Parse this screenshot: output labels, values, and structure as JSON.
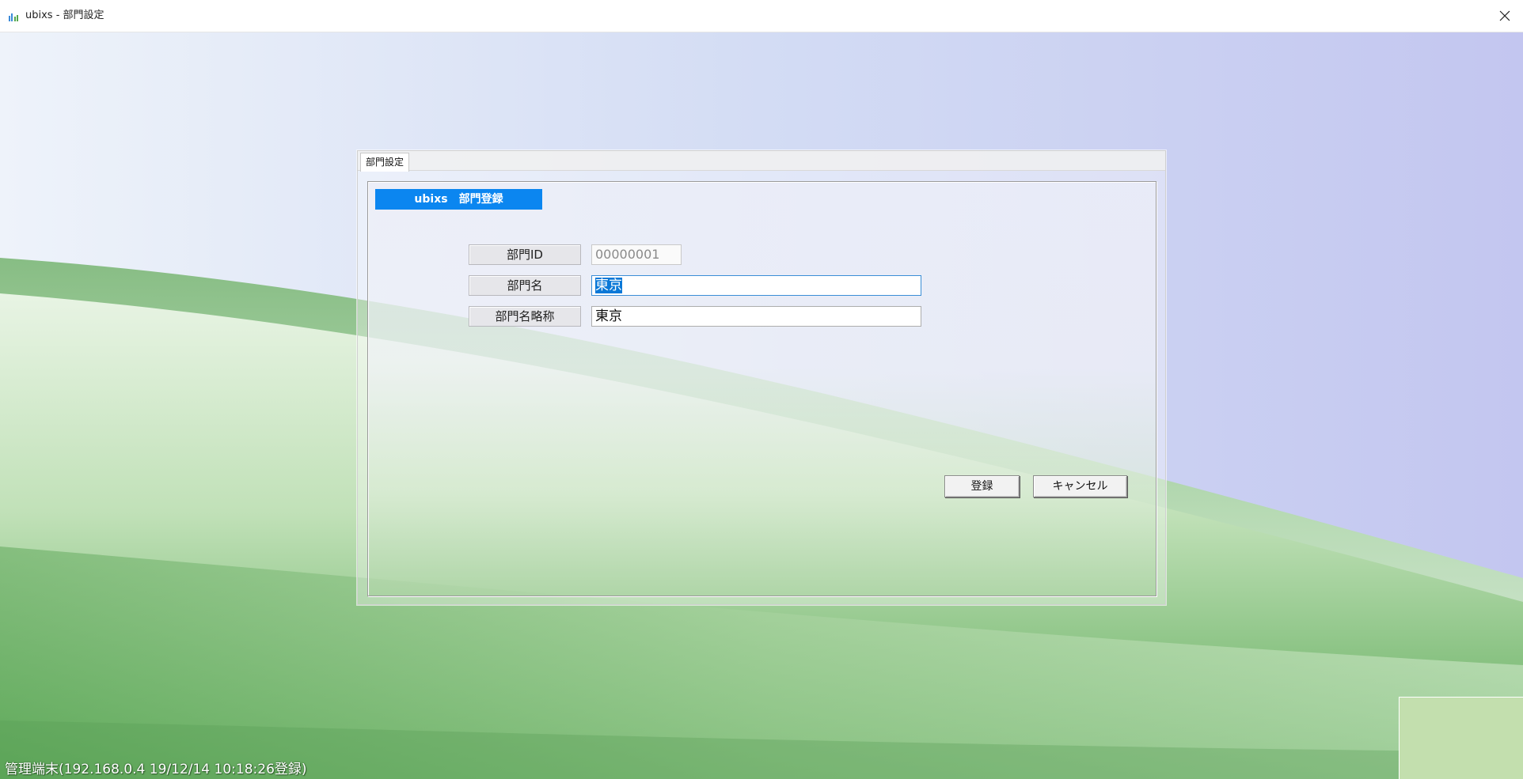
{
  "window": {
    "title": "ubixs - 部門設定"
  },
  "dialog": {
    "tab_label": "部門設定",
    "header": "ubixs　部門登録",
    "fields": [
      {
        "label": "部門ID",
        "value": "00000001",
        "disabled": true
      },
      {
        "label": "部門名",
        "value": "東京",
        "selected": true
      },
      {
        "label": "部門名略称",
        "value": "東京"
      }
    ],
    "buttons": {
      "register": "登録",
      "cancel": "キャンセル"
    }
  },
  "status_bar": {
    "text": "管理端末(192.168.0.4 19/12/14 10:18:26登録)"
  },
  "colors": {
    "header_bg": "#0b86f0",
    "selection": "#0a78d7",
    "corner_box": "#c3dfae"
  },
  "icons": {
    "app": "bar-chart-icon",
    "close": "close-icon"
  }
}
